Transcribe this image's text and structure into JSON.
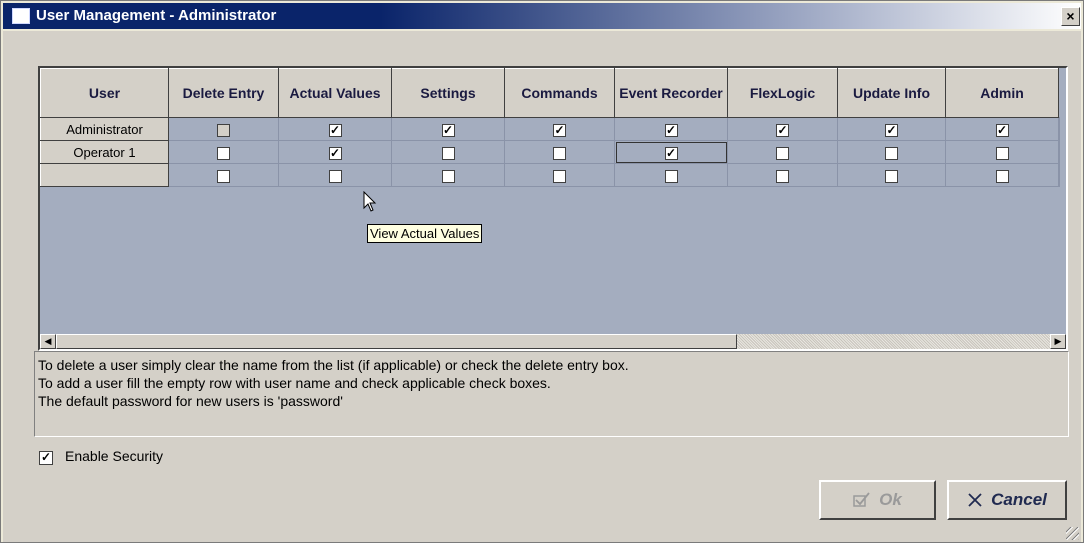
{
  "window": {
    "title": "User Management - Administrator",
    "close_glyph": "×",
    "colors": {
      "titlebar": "#0a246a",
      "grid_bg": "#a4adbf",
      "face": "#d4d0c8"
    }
  },
  "grid": {
    "columns": [
      "User",
      "Delete Entry",
      "Actual Values",
      "Settings",
      "Commands",
      "Event Recorder",
      "FlexLogic",
      "Update Info",
      "Admin"
    ],
    "rows": [
      {
        "user": "Administrator",
        "checks": [
          false,
          true,
          true,
          true,
          true,
          true,
          true,
          true
        ],
        "delete_disabled": true
      },
      {
        "user": "Operator 1",
        "checks": [
          false,
          true,
          false,
          false,
          true,
          false,
          false,
          false
        ],
        "delete_disabled": false
      },
      {
        "user": "",
        "checks": [
          false,
          false,
          false,
          false,
          false,
          false,
          false,
          false
        ],
        "delete_disabled": false
      }
    ]
  },
  "tooltip": {
    "text": "View Actual Values"
  },
  "info": {
    "lines": [
      "To delete a user simply clear the name from the list (if applicable) or check the delete entry box.",
      "To add a user fill the empty row with user name and check applicable check boxes.",
      "The default password for new users is 'password'"
    ]
  },
  "security": {
    "label": "Enable Security",
    "checked": true
  },
  "buttons": {
    "ok_label": "Ok",
    "cancel_label": "Cancel",
    "ok_icon": "checkmark-icon",
    "cancel_icon": "x-icon"
  }
}
